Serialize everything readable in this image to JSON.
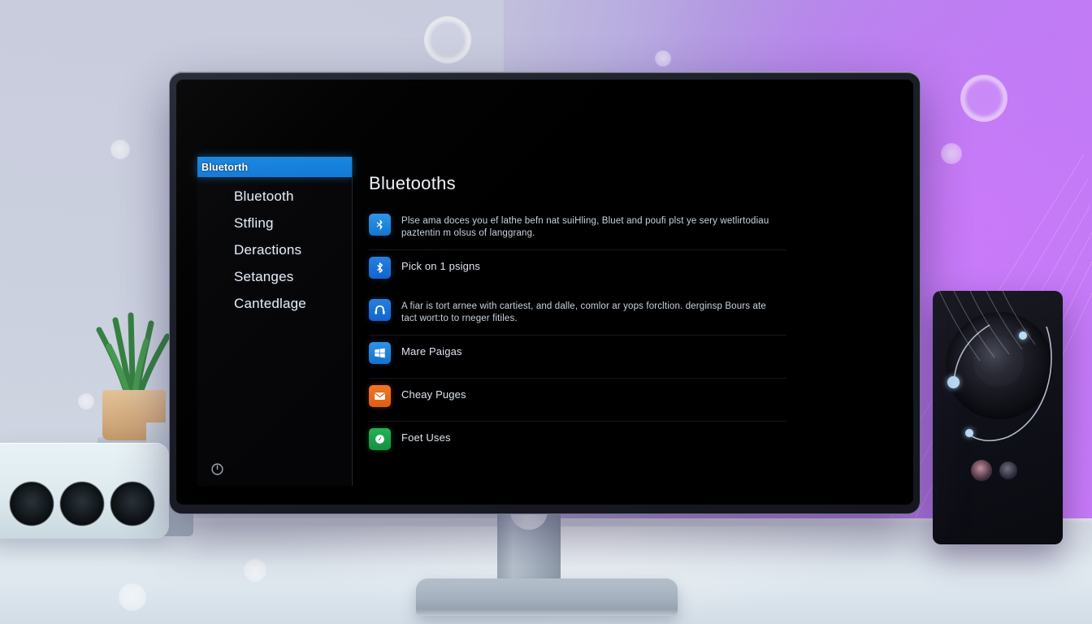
{
  "scene": {
    "description": "Desktop monitor on a white desk showing a dark Bluetooth settings page",
    "background_left_color": "#c8ccdd",
    "background_right_color": "#c879f7",
    "desk_color": "#e6eef3"
  },
  "screen": {
    "background": "#000000",
    "sidebar": {
      "selected_label": "Bluetorth",
      "selected_color": "#1786e0",
      "items": [
        {
          "label": "Bluetooth"
        },
        {
          "label": "Stfling"
        },
        {
          "label": "Deractions"
        },
        {
          "label": "Setanges"
        },
        {
          "label": "Cantedlage"
        }
      ],
      "power_icon": "power-icon"
    },
    "content": {
      "title": "Bluetooths",
      "rows": [
        {
          "icon": "bluetooth-anchor-icon",
          "icon_color": "#1a86e0",
          "text": "Plse ama doces you ef lathe befn nat suiHling, Bluet and poufi plst ye sery wetlirtodiau paztentin m olsus of langgrang."
        },
        {
          "icon": "bluetooth-icon",
          "icon_color": "#1668d8",
          "text": "Pick on 1 psigns"
        },
        {
          "icon": "headphones-icon",
          "icon_color": "#1668d8",
          "text": "A fiar is tort arnee with cartiest, and dalle, comlor ar yops forcltion. derginsp Bours ate tact wort:to to rneger fitiles."
        },
        {
          "icon": "windows-icon",
          "icon_color": "#1e84dc",
          "text": "Mare Paigas"
        },
        {
          "icon": "mail-icon",
          "icon_color": "#e8661a",
          "text": "Cheay Puges"
        },
        {
          "icon": "edge-compass-icon",
          "icon_color": "#1aa34a",
          "text": "Foet Uses"
        }
      ]
    }
  },
  "props": {
    "plant": {
      "name": "potted-plant",
      "pot_color": "#d6b084",
      "leaf_color": "#2f7d3a"
    },
    "left_device": {
      "name": "white-audio-interface",
      "port_count": 3,
      "body_color": "#e2eef2"
    },
    "speaker": {
      "name": "desk-speaker",
      "body_color": "#12131a",
      "accent_dot_color": "#bcdcf5"
    },
    "stand": {
      "name": "monitor-stand",
      "color": "#a9b5c2"
    }
  }
}
